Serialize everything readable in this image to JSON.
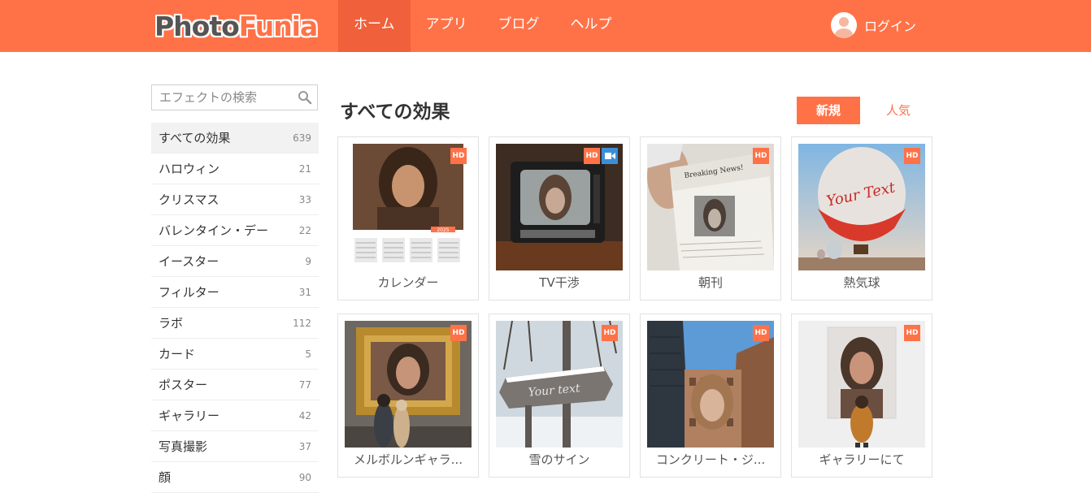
{
  "header": {
    "logo_part1": "Photo",
    "logo_part2": "Funia",
    "nav": [
      "ホーム",
      "アプリ",
      "ブログ",
      "ヘルプ"
    ],
    "login_label": "ログイン",
    "accent_color": "#ff7247"
  },
  "sidebar": {
    "search_placeholder": "エフェクトの検索",
    "categories": [
      {
        "label": "すべての効果",
        "count": "639"
      },
      {
        "label": "ハロウィン",
        "count": "21"
      },
      {
        "label": "クリスマス",
        "count": "33"
      },
      {
        "label": "バレンタイン・デー",
        "count": "22"
      },
      {
        "label": "イースター",
        "count": "9"
      },
      {
        "label": "フィルター",
        "count": "31"
      },
      {
        "label": "ラボ",
        "count": "112"
      },
      {
        "label": "カード",
        "count": "5"
      },
      {
        "label": "ポスター",
        "count": "77"
      },
      {
        "label": "ギャラリー",
        "count": "42"
      },
      {
        "label": "写真撮影",
        "count": "37"
      },
      {
        "label": "顔",
        "count": "90"
      }
    ]
  },
  "main": {
    "title": "すべての効果",
    "sort_new": "新規",
    "sort_popular": "人気",
    "badge_hd": "HD",
    "calendar_year": "2025",
    "sign_text": "Your text",
    "balloon_text": "Your Text",
    "newspaper_text": "Breaking News!",
    "effects": [
      {
        "label": "カレンダー",
        "video": false
      },
      {
        "label": "TV干渉",
        "video": true
      },
      {
        "label": "朝刊",
        "video": false
      },
      {
        "label": "熱気球",
        "video": false
      },
      {
        "label": "メルボルンギャラ...",
        "video": false
      },
      {
        "label": "雪のサイン",
        "video": false
      },
      {
        "label": "コンクリート・ジ...",
        "video": false
      },
      {
        "label": "ギャラリーにて",
        "video": false
      }
    ]
  }
}
